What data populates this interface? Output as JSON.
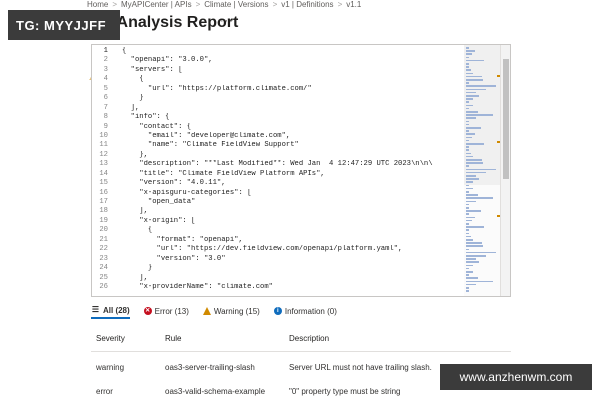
{
  "breadcrumb": [
    "Home",
    "MyAPICenter | APIs",
    "Climate | Versions",
    "v1 | Definitions",
    "v1.1"
  ],
  "watermarks": {
    "top_left": "TG: MYYJJFF",
    "bottom_right": "www.anzhenwm.com"
  },
  "page": {
    "title": "API Analysis Report",
    "title_visible": "API Analysis Report",
    "more": "···"
  },
  "editor": {
    "lines": [
      {
        "n": "1",
        "t": "{"
      },
      {
        "n": "2",
        "t": "  \"openapi\": \"3.0.0\","
      },
      {
        "n": "3",
        "t": "  \"servers\": ["
      },
      {
        "n": "4",
        "t": "    {"
      },
      {
        "n": "5",
        "t": "      \"url\": \"https://platform.climate.com/\""
      },
      {
        "n": "6",
        "t": "    }"
      },
      {
        "n": "7",
        "t": "  ],"
      },
      {
        "n": "8",
        "t": "  \"info\": {"
      },
      {
        "n": "9",
        "t": "    \"contact\": {"
      },
      {
        "n": "10",
        "t": "      \"email\": \"developer@climate.com\","
      },
      {
        "n": "11",
        "t": "      \"name\": \"Climate FieldView Support\""
      },
      {
        "n": "12",
        "t": "    },"
      },
      {
        "n": "13",
        "t": "    \"description\": \"**Last Modified**: Wed Jan  4 12:47:29 UTC 2023\\n\\n\\"
      },
      {
        "n": "14",
        "t": "    \"title\": \"Climate FieldView Platform APIs\","
      },
      {
        "n": "15",
        "t": "    \"version\": \"4.0.11\","
      },
      {
        "n": "16",
        "t": "    \"x-apisguru-categories\": ["
      },
      {
        "n": "17",
        "t": "      \"open_data\""
      },
      {
        "n": "18",
        "t": "    ],"
      },
      {
        "n": "19",
        "t": "    \"x-origin\": ["
      },
      {
        "n": "20",
        "t": "      {"
      },
      {
        "n": "21",
        "t": "        \"format\": \"openapi\","
      },
      {
        "n": "22",
        "t": "        \"url\": \"https://dev.fieldview.com/openapi/platform.yaml\","
      },
      {
        "n": "23",
        "t": "        \"version\": \"3.0\""
      },
      {
        "n": "24",
        "t": "      }"
      },
      {
        "n": "25",
        "t": "    ],"
      },
      {
        "n": "26",
        "t": "    \"x-providerName\": \"climate.com\""
      }
    ]
  },
  "tabs": [
    {
      "icon": "list-icon",
      "label": "All (28)",
      "selected": true
    },
    {
      "icon": "error-icon",
      "label": "Error (13)",
      "selected": false
    },
    {
      "icon": "warning-icon",
      "label": "Warning (15)",
      "selected": false
    },
    {
      "icon": "info-icon",
      "label": "Information (0)",
      "selected": false
    }
  ],
  "table": {
    "headers": {
      "severity": "Severity",
      "rule": "Rule",
      "description": "Description"
    },
    "rows": [
      {
        "severity": "warning",
        "rule": "oas3-server-trailing-slash",
        "description": "Server URL must not have trailing slash."
      },
      {
        "severity": "error",
        "rule": "oas3-valid-schema-example",
        "description": "\"0\" property type must be string"
      }
    ]
  },
  "colors": {
    "accent": "#0f6cbd",
    "error": "#c50f1f",
    "warning": "#d08a00"
  }
}
